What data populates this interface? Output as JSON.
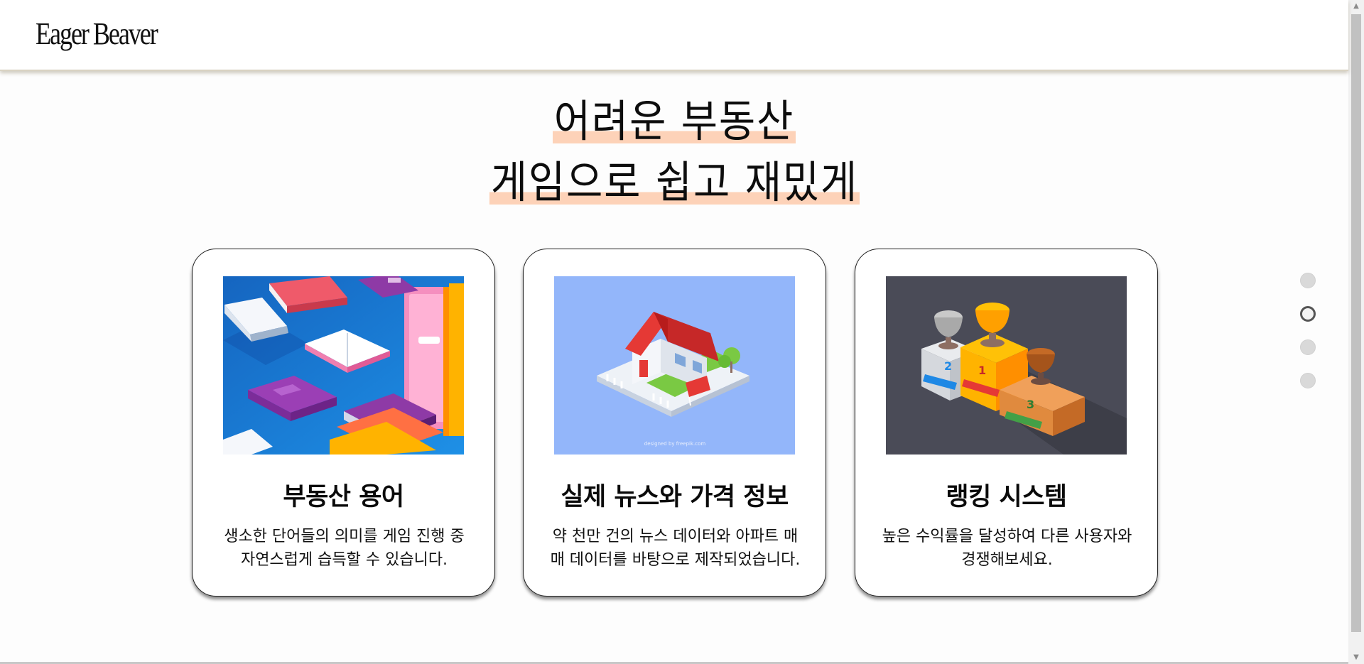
{
  "header": {
    "logo": "Eager Beaver"
  },
  "hero": {
    "line1": "어려운 부동산",
    "line2": "게임으로 쉽고 재밌게"
  },
  "cards": [
    {
      "title": "부동산 용어",
      "desc_line1": "생소한 단어들의 의미를 게임 진행 중",
      "desc_line2": "자연스럽게 습득할 수 있습니다.",
      "image": "books-illustration",
      "bg": "#1e7fd6"
    },
    {
      "title": "실제 뉴스와 가격 정보",
      "desc_line1": "약 천만 건의 뉴스 데이터와 아파트 매",
      "desc_line2": "매 데이터를 바탕으로 제작되었습니다.",
      "image": "house-illustration",
      "bg": "#93b6fa",
      "image_caption": "designed by freepik.com"
    },
    {
      "title": "랭킹 시스템",
      "desc_line1": "높은 수익률을 달성하여 다른 사용자와",
      "desc_line2": "경쟁해보세요.",
      "image": "trophy-podium-illustration",
      "bg": "#4a4b57"
    }
  ],
  "pagination": {
    "count": 4,
    "active_index": 1
  },
  "colors": {
    "highlight": "#fdd2b8",
    "accent_dot": "#555555"
  }
}
